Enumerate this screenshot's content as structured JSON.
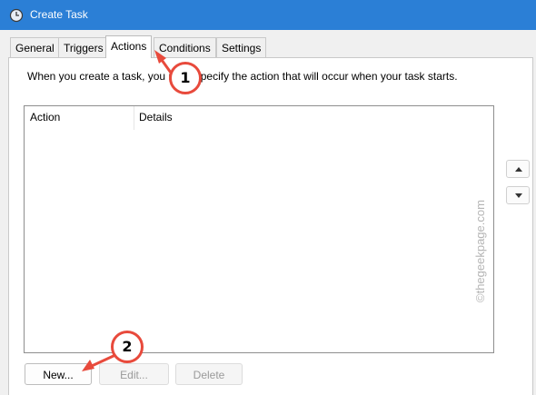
{
  "window": {
    "title": "Create Task"
  },
  "tabs": [
    {
      "label": "General"
    },
    {
      "label": "Triggers"
    },
    {
      "label": "Actions"
    },
    {
      "label": "Conditions"
    },
    {
      "label": "Settings"
    }
  ],
  "active_tab": "Actions",
  "intro_text": "When you create a task, you must specify the action that will occur when your task starts.",
  "table": {
    "columns": [
      "Action",
      "Details"
    ],
    "rows": []
  },
  "buttons": {
    "new": "New...",
    "edit": "Edit...",
    "delete": "Delete"
  },
  "callouts": [
    "1",
    "2"
  ],
  "watermark": "©thegeekpage.com",
  "colors": {
    "titlebar": "#2b7fd6",
    "callout": "#e84a3c"
  }
}
